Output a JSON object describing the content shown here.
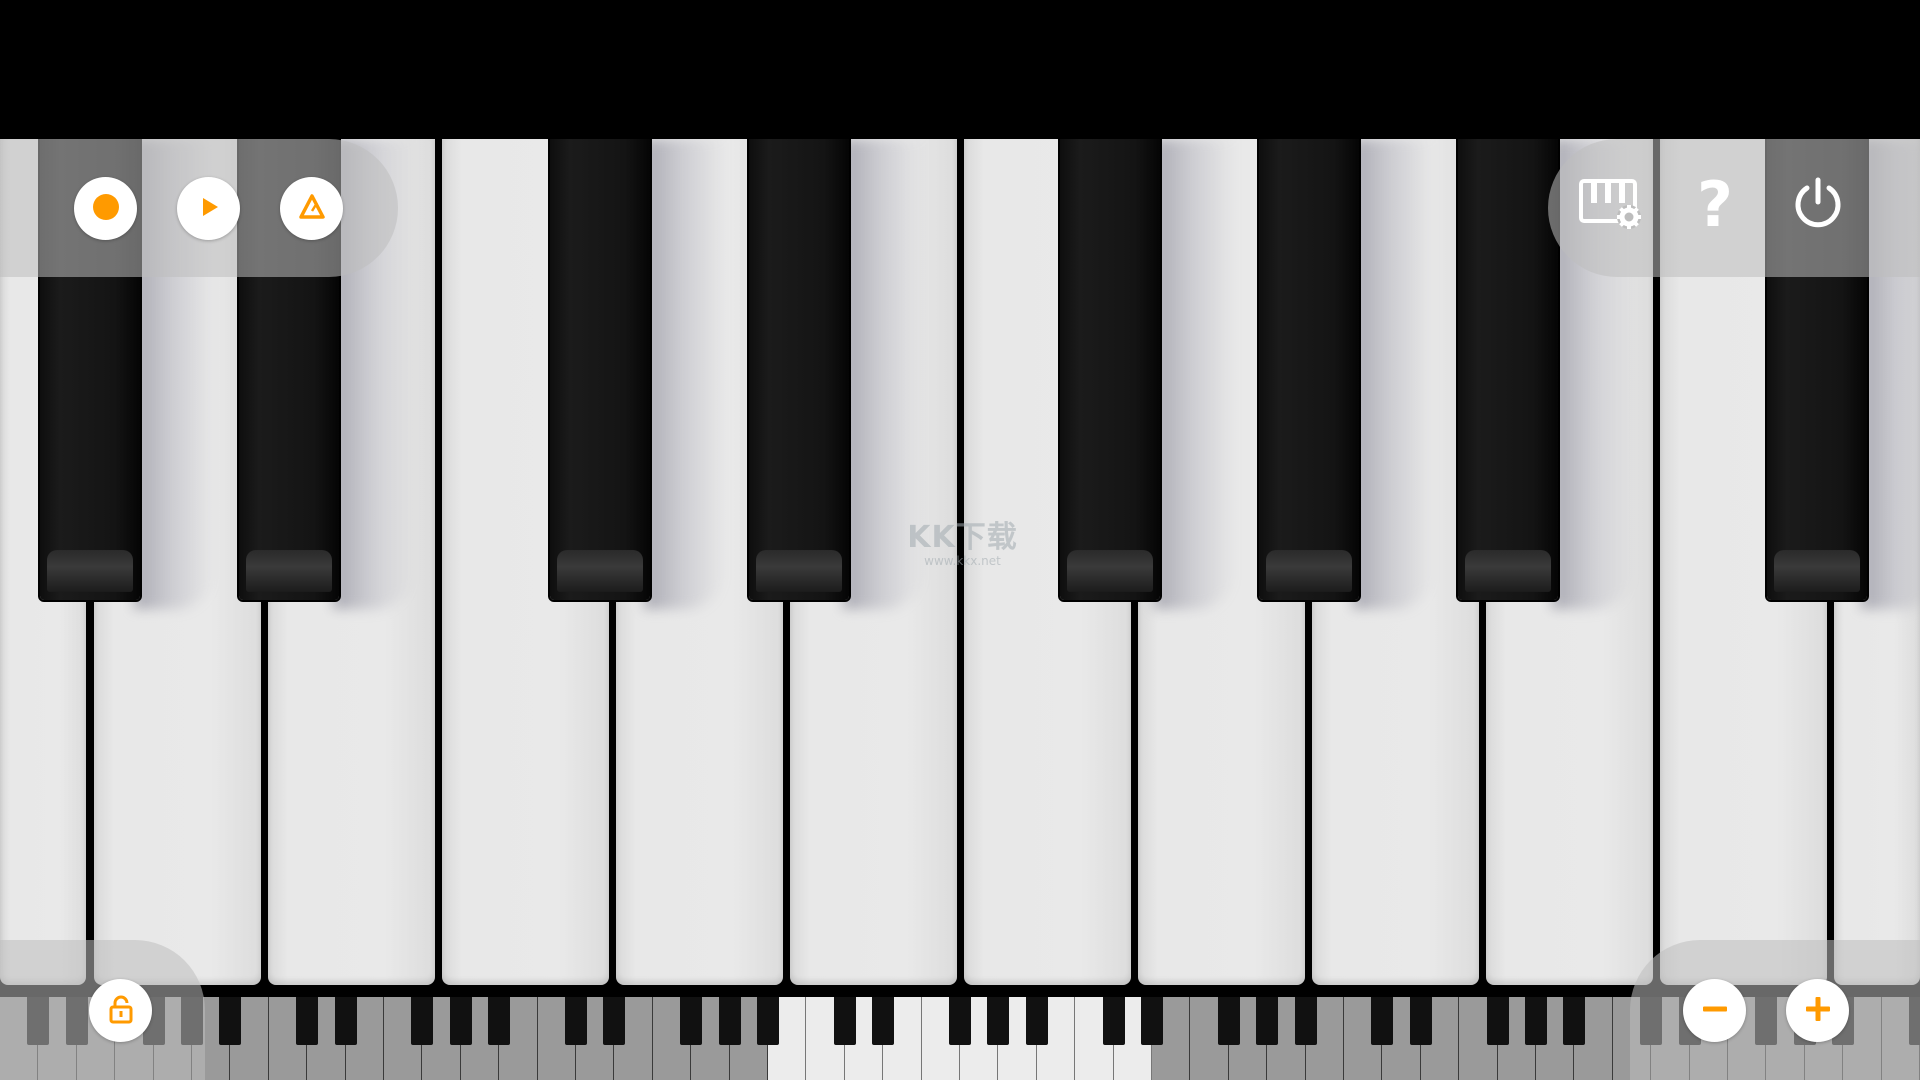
{
  "app": {
    "accent_color": "#FF9A00",
    "key_colors": {
      "white": "#E8E8E8",
      "black": "#141414"
    }
  },
  "toolbar_left": {
    "buttons": [
      {
        "id": "record",
        "icon": "record-icon"
      },
      {
        "id": "play",
        "icon": "play-icon"
      },
      {
        "id": "metronome",
        "icon": "metronome-icon"
      }
    ]
  },
  "toolbar_right": {
    "buttons": [
      {
        "id": "keyboard-settings",
        "icon": "piano-settings-icon"
      },
      {
        "id": "help",
        "icon": "help-icon",
        "label": "?"
      },
      {
        "id": "power",
        "icon": "power-icon"
      }
    ]
  },
  "bottom_left": {
    "lock_icon": "lock-icon"
  },
  "bottom_right": {
    "zoom_out_icon": "minus-icon",
    "zoom_in_icon": "plus-icon"
  },
  "keyboard": {
    "visible_white_keys": 11,
    "highlight_range_on_overview": "visible"
  },
  "watermark": {
    "logo": "KK下载",
    "url": "www.kkx.net"
  }
}
